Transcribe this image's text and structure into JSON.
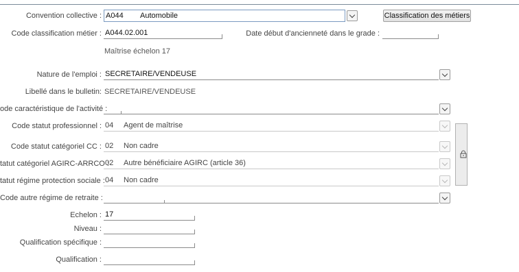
{
  "labels": {
    "convention": "Convention collective :",
    "code_classif": "Code classification métier :",
    "date_debut": "Date début d'ancienneté dans le grade :",
    "nature_emploi": "Nature de l'emploi :",
    "libelle_bulletin": "Libellé dans le bulletin:",
    "code_carac": "ode caractéristique de l'activité :",
    "statut_pro": "Code statut professionnel :",
    "statut_cat_cc": "Code statut catégoriel CC :",
    "statut_agirc": "tatut catégoriel AGIRC-ARRCO :",
    "statut_protection": "tatut régime protection sociale :",
    "autre_regime": "Code autre régime de retraite :",
    "echelon": "Echelon :",
    "niveau": "Niveau :",
    "qualif_specifique": "Qualification spécifique :",
    "qualification": "Qualification :"
  },
  "values": {
    "convention_code": "A044",
    "convention_name": "Automobile",
    "code_classif": "A044.02.001",
    "classif_desc": "Maîtrise échelon 17",
    "date_debut": "",
    "nature_emploi": "SECRETAIRE/VENDEUSE",
    "libelle_bulletin": "SECRETAIRE/VENDEUSE",
    "code_carac": "",
    "statut_pro_code": "04",
    "statut_pro_label": "Agent de maîtrise",
    "statut_cat_cc_code": "02",
    "statut_cat_cc_label": "Non cadre",
    "statut_agirc_code": "02",
    "statut_agirc_label": "Autre bénéficiaire AGIRC (article 36)",
    "statut_protection_code": "04",
    "statut_protection_label": "Non cadre",
    "autre_regime": "",
    "echelon": "17",
    "niveau": "",
    "qualif_specifique": "",
    "qualification": ""
  },
  "buttons": {
    "classification": "Classification des métiers"
  },
  "icons": {
    "dropdown": "chevron-down-icon",
    "lock": "lock-icon"
  }
}
